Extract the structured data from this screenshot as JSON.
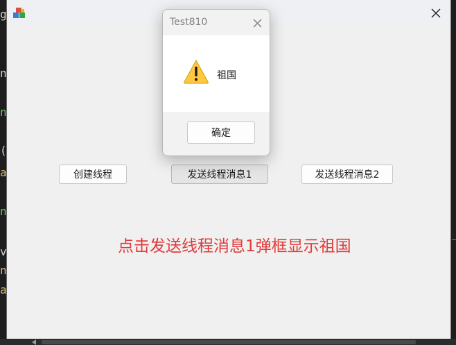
{
  "background": {
    "chars": [
      "g",
      "n",
      "ns",
      "(",
      "ag",
      "ns",
      "v",
      "na",
      "ag"
    ]
  },
  "window": {
    "close_icon": "close-icon",
    "app_icon": "app-icon"
  },
  "buttons": {
    "create_thread": "创建线程",
    "send_msg_1": "发送线程消息1",
    "send_msg_2": "发送线程消息2"
  },
  "note": "点击发送线程消息1弹框显示祖国",
  "msgbox": {
    "title": "Test810",
    "message": "祖国",
    "ok_label": "确定",
    "icon": "warning-icon"
  },
  "colors": {
    "note": "#e03b3b",
    "warning_fill": "#ffc83d",
    "window_bg": "#f0f0f0"
  }
}
